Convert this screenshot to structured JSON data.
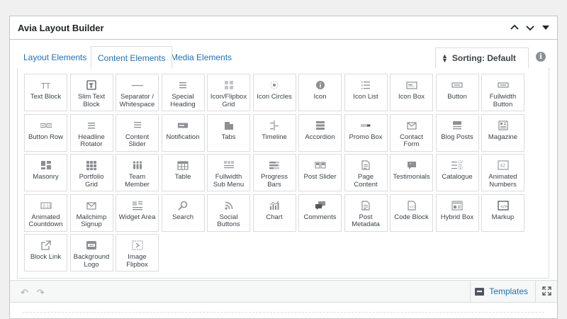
{
  "panel": {
    "title": "Avia Layout Builder"
  },
  "tabs": [
    {
      "label": "Layout Elements"
    },
    {
      "label": "Content Elements"
    },
    {
      "label": "Media Elements"
    }
  ],
  "sorting": {
    "label": "Sorting: Default"
  },
  "elements": [
    {
      "label": "Text Block",
      "icon": "text-block"
    },
    {
      "label": "Slim Text Block",
      "icon": "slim-text"
    },
    {
      "label": "Separator / Whitespace",
      "icon": "separator"
    },
    {
      "label": "Special Heading",
      "icon": "heading"
    },
    {
      "label": "Icon/Flipbox Grid",
      "icon": "grid"
    },
    {
      "label": "Icon Circles",
      "icon": "icon-circles"
    },
    {
      "label": "Icon",
      "icon": "info"
    },
    {
      "label": "Icon List",
      "icon": "list"
    },
    {
      "label": "Icon Box",
      "icon": "box"
    },
    {
      "label": "Button",
      "icon": "button"
    },
    {
      "label": "Fullwidth Button",
      "icon": "button"
    },
    {
      "label": "Button Row",
      "icon": "button-row"
    },
    {
      "label": "Headline Rotator",
      "icon": "heading"
    },
    {
      "label": "Content Slider",
      "icon": "lines"
    },
    {
      "label": "Notification",
      "icon": "notification"
    },
    {
      "label": "Tabs",
      "icon": "tabs"
    },
    {
      "label": "Timeline",
      "icon": "timeline"
    },
    {
      "label": "Accordion",
      "icon": "accordion"
    },
    {
      "label": "Promo Box",
      "icon": "promo"
    },
    {
      "label": "Contact Form",
      "icon": "mail"
    },
    {
      "label": "Blog Posts",
      "icon": "blog"
    },
    {
      "label": "Magazine",
      "icon": "magazine"
    },
    {
      "label": "Masonry",
      "icon": "masonry"
    },
    {
      "label": "Portfolio Grid",
      "icon": "portfolio"
    },
    {
      "label": "Team Member",
      "icon": "team"
    },
    {
      "label": "Table",
      "icon": "table"
    },
    {
      "label": "Fullwidth Sub Menu",
      "icon": "submenu"
    },
    {
      "label": "Progress Bars",
      "icon": "progress"
    },
    {
      "label": "Post Slider",
      "icon": "post-slider"
    },
    {
      "label": "Page Content",
      "icon": "page"
    },
    {
      "label": "Testimonials",
      "icon": "quote"
    },
    {
      "label": "Catalogue",
      "icon": "catalogue"
    },
    {
      "label": "Animated Numbers",
      "icon": "numbers"
    },
    {
      "label": "Animated Countdown",
      "icon": "countdown"
    },
    {
      "label": "Mailchimp Signup",
      "icon": "mail"
    },
    {
      "label": "Widget Area",
      "icon": "widget"
    },
    {
      "label": "Search",
      "icon": "search"
    },
    {
      "label": "Social Buttons",
      "icon": "rss"
    },
    {
      "label": "Chart",
      "icon": "chart"
    },
    {
      "label": "Comments",
      "icon": "comments"
    },
    {
      "label": "Post Metadata",
      "icon": "page"
    },
    {
      "label": "Code Block",
      "icon": "code"
    },
    {
      "label": "Hybrid Box",
      "icon": "hybrid"
    },
    {
      "label": "Markup",
      "icon": "markup"
    },
    {
      "label": "Block Link",
      "icon": "external"
    },
    {
      "label": "Background Logo",
      "icon": "bg-logo"
    },
    {
      "label": "Image Flipbox",
      "icon": "flipbox"
    }
  ],
  "footer": {
    "templates_label": "Templates"
  }
}
